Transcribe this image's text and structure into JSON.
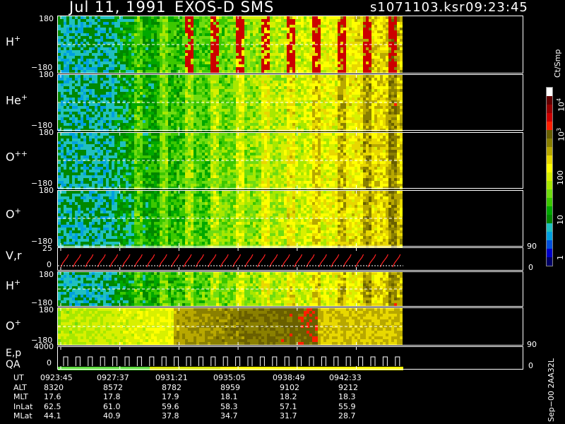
{
  "header": {
    "date": "Jul 11, 1991",
    "instrument": "EXOS-D SMS",
    "file": "s1071103.ksr",
    "time": "09:23:45"
  },
  "colorbar": {
    "unit": "Ct/Smp",
    "ticks": [
      "1",
      "10",
      "100",
      "10",
      "10"
    ],
    "exponents": [
      "3",
      "4"
    ],
    "colors": [
      "#000066",
      "#0000cc",
      "#0050dd",
      "#00a0e0",
      "#20c0c0",
      "#008800",
      "#00a800",
      "#3cc800",
      "#70dc10",
      "#a8e800",
      "#d8f000",
      "#ffff00",
      "#e8d800",
      "#b8a800",
      "#8a8000",
      "#6a6000",
      "#ff2000",
      "#cc0000",
      "#990000",
      "#660000",
      "#ffffff"
    ]
  },
  "panels": {
    "h_plus": {
      "label": "H",
      "sup": "+",
      "top": "180",
      "bottom": "−180"
    },
    "he_plus": {
      "label": "He",
      "sup": "+",
      "top": "180",
      "bottom": "−180"
    },
    "o_pp": {
      "label": "O",
      "sup": "++",
      "top": "180",
      "bottom": "−180"
    },
    "o_plus": {
      "label": "O",
      "sup": "+",
      "top": "180",
      "bottom": "−180"
    },
    "vr": {
      "label": "V,r",
      "top": "25",
      "bottom": "0",
      "right_top": "90",
      "right_bottom": "0"
    },
    "h_plus2": {
      "label": "H",
      "sup": "+",
      "top": "180",
      "bottom": "−180"
    },
    "o_plus2": {
      "label": "O",
      "sup": "+",
      "top": "180",
      "bottom": "−180"
    },
    "ep": {
      "label1": "E,p",
      "label2": "QA",
      "top": "4000",
      "bottom": "0",
      "right_top": "90",
      "right_bottom": "0"
    }
  },
  "footer": {
    "labels": [
      "UT",
      "ALT",
      "MLT",
      "InLat",
      "MLat"
    ],
    "columns": [
      [
        "0923:45",
        "8320",
        "17.6",
        "62.5",
        "44.1"
      ],
      [
        "0927:37",
        "8572",
        "17.8",
        "61.0",
        "40.9"
      ],
      [
        "0931:21",
        "8782",
        "17.9",
        "59.6",
        "37.8"
      ],
      [
        "0935:05",
        "8959",
        "18.1",
        "58.3",
        "34.7"
      ],
      [
        "0938:49",
        "9102",
        "18.2",
        "57.1",
        "31.7"
      ],
      [
        "0942:33",
        "9212",
        "18.3",
        "55.9",
        "28.7"
      ]
    ]
  },
  "stamp": "Sep−00 2AA32L",
  "chart_data": [
    {
      "type": "heatmap",
      "ylabel": "H+",
      "ylim": [
        -180,
        180
      ],
      "x": [
        "0923:45",
        "0927:37",
        "0931:21",
        "0935:05",
        "0938:49",
        "0942:33"
      ],
      "ramp": "increasing"
    },
    {
      "type": "heatmap",
      "ylabel": "He+",
      "ylim": [
        -180,
        180
      ],
      "x": [
        "0923:45",
        "0927:37",
        "0931:21",
        "0935:05",
        "0938:49",
        "0942:33"
      ],
      "ramp": "increasing"
    },
    {
      "type": "heatmap",
      "ylabel": "O++",
      "ylim": [
        -180,
        180
      ],
      "x": [
        "0923:45",
        "0927:37",
        "0931:21",
        "0935:05",
        "0938:49",
        "0942:33"
      ],
      "ramp": "increasing"
    },
    {
      "type": "heatmap",
      "ylabel": "O+",
      "ylim": [
        -180,
        180
      ],
      "x": [
        "0923:45",
        "0927:37",
        "0931:21",
        "0935:05",
        "0938:49",
        "0942:33"
      ],
      "ramp": "increasing"
    },
    {
      "type": "line",
      "ylabel": "V,r",
      "ylim": [
        0,
        25
      ],
      "y2lim": [
        0,
        90
      ],
      "sweeps": 28
    },
    {
      "type": "heatmap",
      "ylabel": "H+",
      "ylim": [
        -180,
        180
      ],
      "x": [
        "0923:45",
        "0927:37",
        "0931:21",
        "0935:05",
        "0938:49",
        "0942:33"
      ],
      "ramp": "increasing"
    },
    {
      "type": "heatmap",
      "ylabel": "O+",
      "ylim": [
        -180,
        180
      ],
      "x": [
        "0923:45",
        "0927:37",
        "0931:21",
        "0935:05",
        "0938:49",
        "0942:33"
      ],
      "ramp": "increasing"
    },
    {
      "type": "line",
      "ylabel": "E,p",
      "ylim": [
        0,
        4000
      ],
      "y2lim": [
        0,
        90
      ],
      "sweeps": 28
    }
  ]
}
